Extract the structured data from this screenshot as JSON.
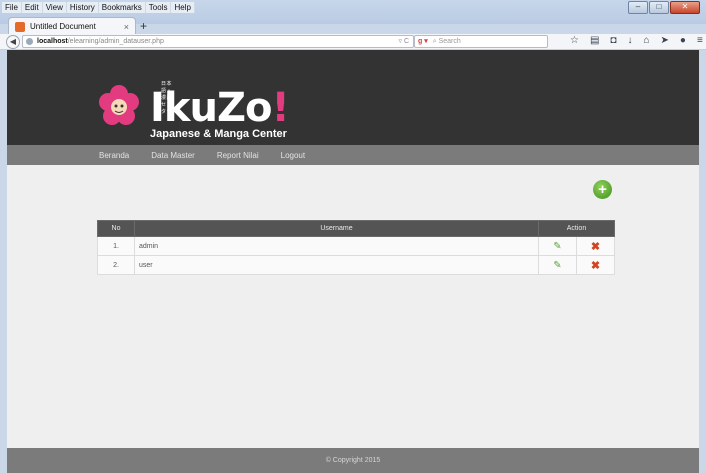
{
  "browser": {
    "menu": [
      "File",
      "Edit",
      "View",
      "History",
      "Bookmarks",
      "Tools",
      "Help"
    ],
    "tab_title": "Untitled Document",
    "tab_close": "×",
    "new_tab": "+",
    "url_host": "localhost",
    "url_path": "/elearning/admin_datauser.php",
    "search_placeholder": "Search",
    "toolbar_icons": [
      "star-icon",
      "reading-list-icon",
      "pocket-icon",
      "download-icon",
      "home-icon",
      "send-icon",
      "chat-icon",
      "menu-icon"
    ]
  },
  "site": {
    "logo_text_main": "IkuZo",
    "logo_text_bang": "!",
    "logo_jp": "日本語・漫画センター",
    "logo_sub": "Japanese & Manga Center",
    "nav": [
      "Beranda",
      "Data Master",
      "Report Nilai",
      "Logout"
    ],
    "add_button_symbol": "+",
    "table": {
      "headers": [
        "No",
        "Username",
        "Action"
      ],
      "rows": [
        {
          "no": "1.",
          "username": "admin"
        },
        {
          "no": "2.",
          "username": "user"
        }
      ]
    },
    "footer": "© Copyright 2015"
  },
  "colors": {
    "header_bg": "#333333",
    "nav_bg": "#7b7b7b",
    "accent_pink": "#e33b80",
    "add_green": "#4a9a24",
    "delete_red": "#d2461f"
  }
}
